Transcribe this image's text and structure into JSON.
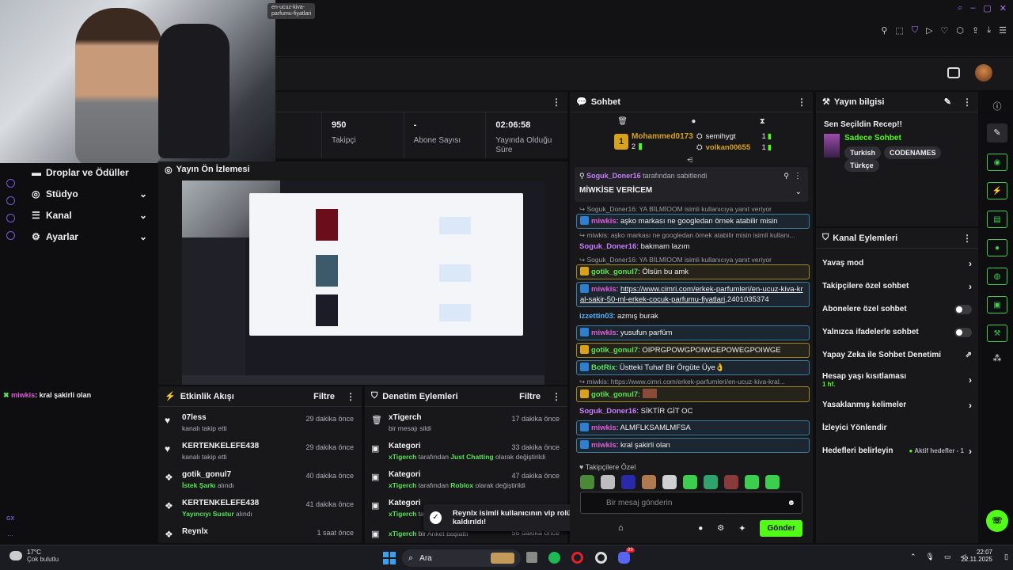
{
  "webcam_tooltip": {
    "line1": "en-ucuz-kiva-",
    "line2": "parfumu-fiyatlari"
  },
  "stats": [
    {
      "value": "950",
      "label": "Takipçi"
    },
    {
      "value": "-",
      "label": "Abone Sayısı"
    },
    {
      "value": "02:06:58",
      "label": "Yayında Olduğu Süre"
    }
  ],
  "sidebar": {
    "items": [
      {
        "label": "Droplar ve Ödüller"
      },
      {
        "label": "Stüdyo"
      },
      {
        "label": "Kanal"
      },
      {
        "label": "Ayarlar"
      }
    ],
    "gx_label": "GX"
  },
  "overlay_chat": {
    "user": "miwkis",
    "text": ": kral şakirli olan"
  },
  "preview": {
    "title": "Yayın Ön İzlemesi"
  },
  "activity": {
    "title": "Etkinlik Akışı",
    "filter": "Filtre",
    "items": [
      {
        "user": "07less",
        "sub": "kanalı takip etti",
        "time": "29 dakika önce"
      },
      {
        "user": "KERTENKELEFE438",
        "sub": "kanalı takip etti",
        "time": "29 dakika önce"
      },
      {
        "user": "gotik_gonul7",
        "sub_hl": "İstek Şarkı",
        "sub": " alındı",
        "time": "40 dakika önce"
      },
      {
        "user": "KERTENKELEFE438",
        "sub_hl": "Yayıncıyı Sustur",
        "sub": " alındı",
        "time": "41 dakika önce"
      },
      {
        "user": "Reynlx",
        "sub": "",
        "time": "1 saat önce"
      }
    ]
  },
  "moderation": {
    "title": "Denetim Eylemleri",
    "filter": "Filtre",
    "items": [
      {
        "title": "xTigerch",
        "sub": "bir mesajı sildi",
        "time": "17 dakika önce"
      },
      {
        "title": "Kategori",
        "user": "xTigerch",
        "mid": " tarafından ",
        "hl": "Just Chatting",
        "end": " olarak değiştirildi",
        "time": "33 dakika önce"
      },
      {
        "title": "Kategori",
        "user": "xTigerch",
        "mid": " tarafından ",
        "hl": "Roblox",
        "end": " olarak değiştirildi",
        "time": "47 dakika önce"
      },
      {
        "title": "Kategori",
        "user": "xTigerch",
        "mid": " ta",
        "hl": "",
        "end": "",
        "time": ""
      },
      {
        "title": "",
        "user": "xTigerch",
        "mid": " bir Anket başlattı",
        "hl": "",
        "end": "",
        "time": "56 dakika önce"
      }
    ]
  },
  "toast": {
    "text": "Reynlx isimli kullanıcının vip rolü kaldırıldı!"
  },
  "chat": {
    "title": "Sohbet",
    "leader": {
      "rank": "1",
      "name": "Mohammed0173",
      "count": "2"
    },
    "leaders_side": [
      {
        "name": "semihygt",
        "count": "1"
      },
      {
        "name": "volkan00655",
        "count": "1"
      }
    ],
    "pinned": {
      "by": "Soguk_Doner16",
      "by_suffix": " tarafından sabitlendi",
      "text": "MİWKİSE VERİCEM"
    },
    "messages": [
      {
        "reply": "Soguk_Doner16: YA BİLMİOOM isimli kullanıcıya yanıt veriyor",
        "user": "miwkis",
        "text": ": aşko markası ne googledan örnek atabilir misin"
      },
      {
        "reply": "miwkis: aşko markası ne googledan örnek atabilir misin isimli kullanı...",
        "user": "Soguk_Doner16",
        "text": ": bakmam lazım"
      },
      {
        "reply": "Soguk_Doner16: YA BİLMİOOM isimli kullanıcıya yanıt veriyor",
        "user": "gotik_gonul7",
        "text": ": Ölsün bu amk"
      },
      {
        "user": "miwkis",
        "link": "https://www.cimri.com/erkek-parfumleri/en-ucuz-kiva-kral-sakir-50-ml-erkek-cocuk-parfumu-fiyatlari",
        "text": ",2401035374"
      },
      {
        "user": "izzettin03",
        "text": ": azmış burak"
      },
      {
        "user": "miwkis",
        "text": ": yusufun parfüm"
      },
      {
        "user": "gotik_gonul7",
        "text": ": OIPRGPOWGPOIWGEPOWEGPOIWGE"
      },
      {
        "user": "BotRix",
        "text": ": Üstteki Tuhaf Bir Örgüte Üye👌"
      },
      {
        "reply": "miwkis: https://www.cimri.com/erkek-parfumleri/en-ucuz-kiva-kral...",
        "user": "gotik_gonul7",
        "text": ":"
      },
      {
        "user": "Soguk_Doner16",
        "text": ": SİKTİR GİT OC"
      },
      {
        "user": "miwkis",
        "text": ": ALMFLKSAMLMFSA"
      },
      {
        "user": "miwkis",
        "text": ": kral şakirli olan"
      }
    ],
    "emote_label": "Takipçilere Özel",
    "input_placeholder": "Bir mesaj gönderin",
    "send": "Gönder"
  },
  "stream_info": {
    "title": "Yayın bilgisi",
    "stream_title": "Sen Seçildin Recep!!",
    "category": "Sadece Sohbet",
    "tags": [
      "Turkish",
      "CODENAMES",
      "Türkçe"
    ]
  },
  "channel_actions": {
    "title": "Kanal Eylemleri",
    "items": [
      {
        "label": "Yavaş mod",
        "ctrl": "chevron"
      },
      {
        "label": "Takipçilere özel sohbet",
        "ctrl": "chevron"
      },
      {
        "label": "Abonelere özel sohbet",
        "ctrl": "toggle"
      },
      {
        "label": "Yalnızca ifadelerle sohbet",
        "ctrl": "toggle"
      },
      {
        "label": "Yapay Zeka ile Sohbet Denetimi",
        "ctrl": "ext"
      },
      {
        "label": "Hesap yaşı kısıtlaması",
        "sub": "1 hf.",
        "ctrl": "chevron"
      },
      {
        "label": "Yasaklanmış kelimeler",
        "ctrl": "chevron"
      },
      {
        "label": "İzleyici Yönlendir",
        "ctrl": ""
      },
      {
        "label": "Hedefleri belirleyin",
        "status": "Aktif hedefler - 1",
        "ctrl": "chevron"
      }
    ]
  },
  "taskbar": {
    "temp": "17°C",
    "weather": "Çok bulutlu",
    "search": "Ara",
    "time": "22:07",
    "date": "22.11.2025",
    "notif": "99"
  },
  "colors": {
    "accent": "#53fc18",
    "bg": "#0e0e10",
    "panel": "#18181b"
  }
}
